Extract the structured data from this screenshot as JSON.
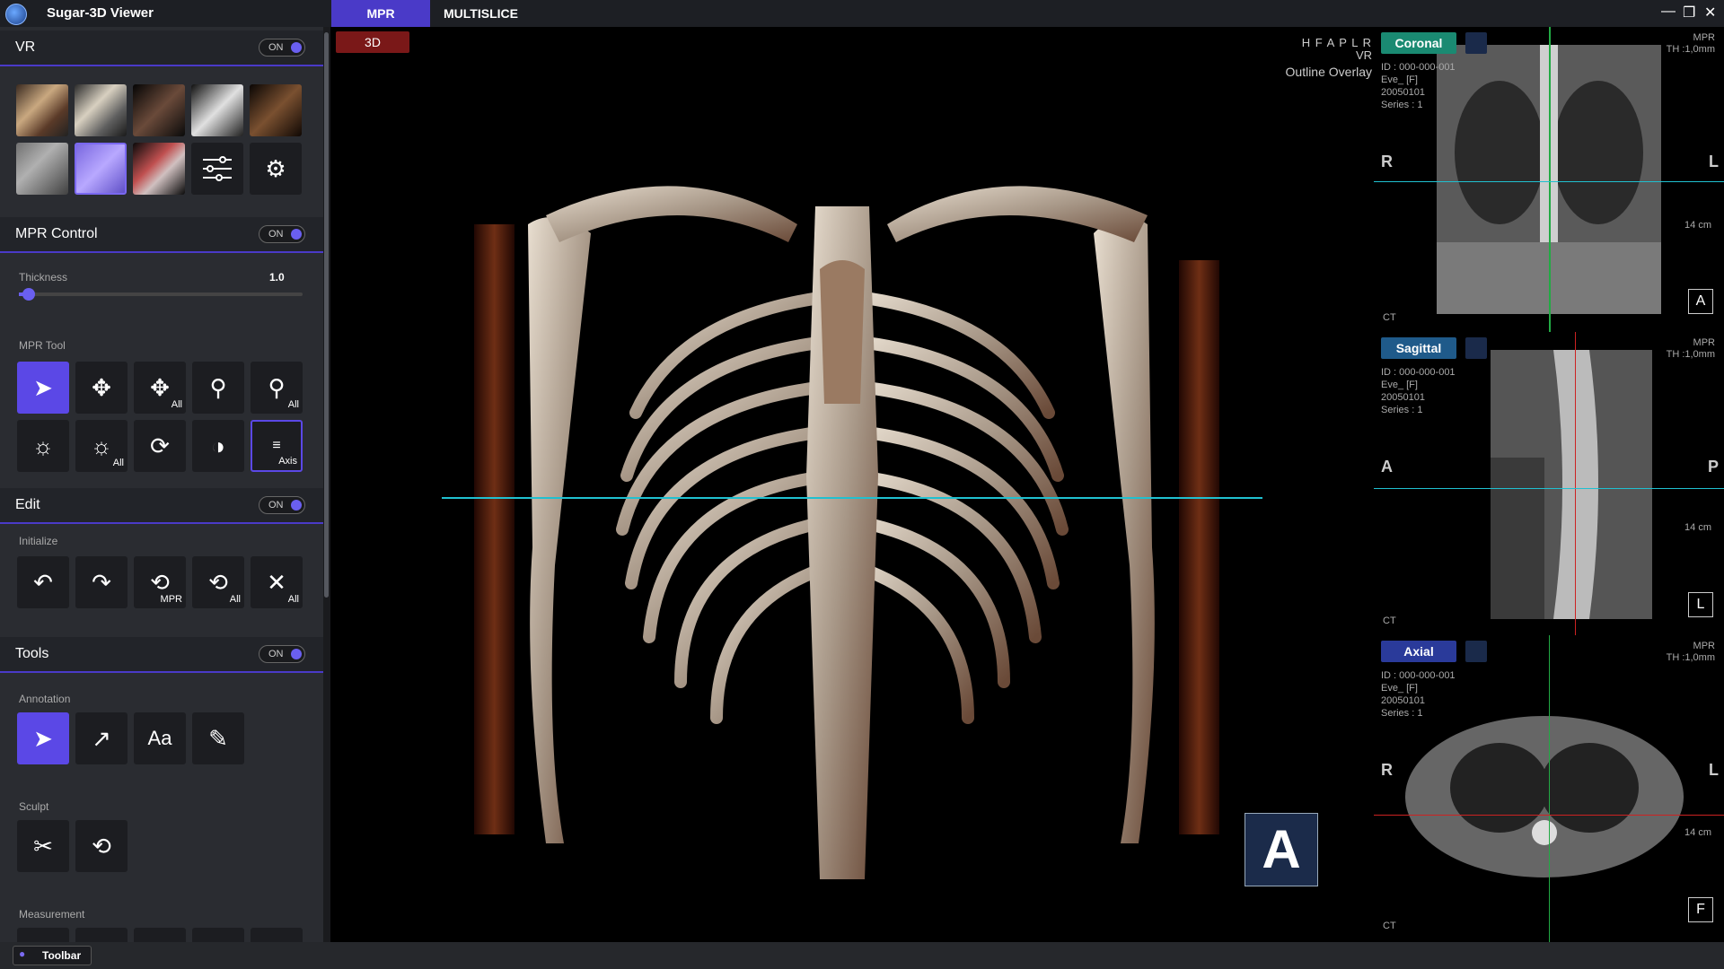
{
  "app": {
    "title": "Sugar-3D Viewer",
    "tabs": [
      "MPR",
      "MULTISLICE"
    ]
  },
  "sidebar": {
    "vr": {
      "title": "VR",
      "toggle": "ON"
    },
    "mpr_control": {
      "title": "MPR Control",
      "toggle": "ON",
      "thickness_label": "Thickness",
      "thickness_value": "1.0"
    },
    "mpr_tool": {
      "label": "MPR Tool",
      "all": "All",
      "axis": "Axis"
    },
    "edit": {
      "title": "Edit",
      "toggle": "ON",
      "initialize_label": "Initialize",
      "mpr": "MPR",
      "all": "All"
    },
    "tools": {
      "title": "Tools",
      "toggle": "ON",
      "annotation_label": "Annotation",
      "text_tool": "Aa",
      "sculpt_label": "Sculpt",
      "measurement_label": "Measurement"
    }
  },
  "viewer": {
    "button_3d": "3D",
    "orientation": "H F A P L R",
    "mode": "VR",
    "overlay": "Outline Overlay",
    "orient_box": "A"
  },
  "panes": [
    {
      "name": "Coronal",
      "tag_color": "#1a8a72",
      "id": "ID : 000-000-001",
      "patient": "Eve_ [F]",
      "date": "20050101",
      "series": "Series : 1",
      "mpr": "MPR",
      "th": "TH :1,0mm",
      "left_dir": "R",
      "right_dir": "L",
      "scale": "14 cm",
      "modality": "CT",
      "corner": "A"
    },
    {
      "name": "Sagittal",
      "tag_color": "#1f5a8a",
      "id": "ID : 000-000-001",
      "patient": "Eve_ [F]",
      "date": "20050101",
      "series": "Series : 1",
      "mpr": "MPR",
      "th": "TH :1,0mm",
      "left_dir": "A",
      "right_dir": "P",
      "scale": "14 cm",
      "modality": "CT",
      "corner": "L"
    },
    {
      "name": "Axial",
      "tag_color": "#2a3a9a",
      "id": "ID : 000-000-001",
      "patient": "Eve_ [F]",
      "date": "20050101",
      "series": "Series : 1",
      "mpr": "MPR",
      "th": "TH :1,0mm",
      "left_dir": "R",
      "right_dir": "L",
      "scale": "14 cm",
      "modality": "CT",
      "corner": "F"
    }
  ],
  "bottom": {
    "toolbar_label": "Toolbar"
  }
}
